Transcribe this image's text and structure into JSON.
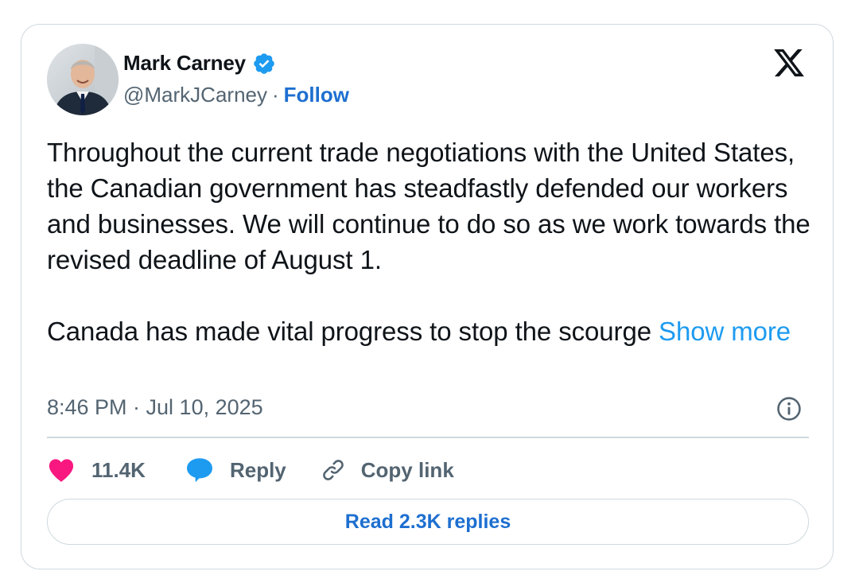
{
  "author": {
    "name": "Mark Carney",
    "handle": "@MarkJCarney",
    "separator": "·",
    "follow_label": "Follow",
    "verified": true
  },
  "tweet": {
    "paragraph1": "Throughout the current trade negotiations with the United States, the Canadian government has steadfastly defended our workers and businesses. We will continue to do so as we work towards the revised deadline of August 1.",
    "paragraph2": "Canada has made vital progress to stop the scourge",
    "show_more": "Show more",
    "timestamp": "8:46 PM · Jul 10, 2025"
  },
  "actions": {
    "likes": "11.4K",
    "reply": "Reply",
    "copy_link": "Copy link"
  },
  "read_replies": "Read 2.3K replies",
  "icons": {
    "verified": "verified-badge-icon",
    "brand": "x-logo-icon",
    "info": "info-icon",
    "like": "heart-icon",
    "reply": "speech-bubble-icon",
    "copy": "link-icon"
  },
  "colors": {
    "link": "#1d6fd0",
    "show_more": "#1d9bf0",
    "verified": "#1d9bf0",
    "heart": "#f91880",
    "reply_bubble": "#1d9bf0",
    "secondary_text": "#536471",
    "border": "#cfd9de"
  }
}
